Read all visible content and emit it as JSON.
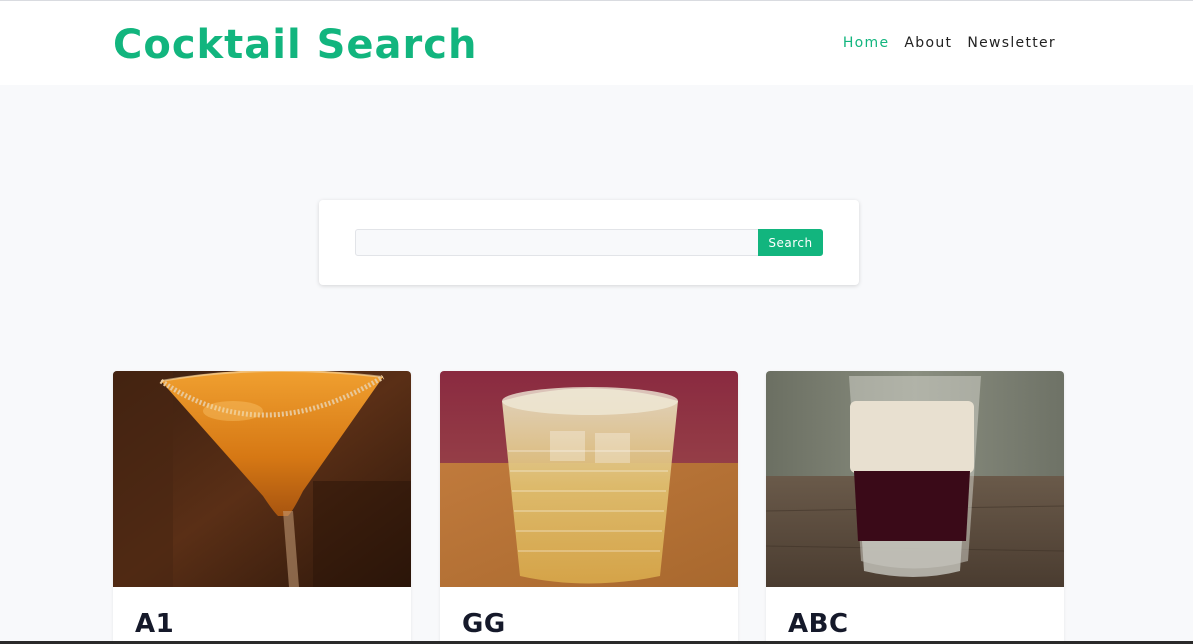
{
  "header": {
    "title": "Cocktail Search",
    "nav": [
      {
        "label": "Home",
        "active": true
      },
      {
        "label": "About",
        "active": false
      },
      {
        "label": "Newsletter",
        "active": false
      }
    ]
  },
  "search": {
    "value": "",
    "placeholder": "",
    "button_label": "Search"
  },
  "cocktails": [
    {
      "name": "A1",
      "image": "orange-martini-photo"
    },
    {
      "name": "GG",
      "image": "ice-tumbler-photo"
    },
    {
      "name": "ABC",
      "image": "layered-shot-photo"
    }
  ],
  "colors": {
    "accent": "#12b57e",
    "background": "#f8f9fb",
    "title_text": "#15192a"
  }
}
